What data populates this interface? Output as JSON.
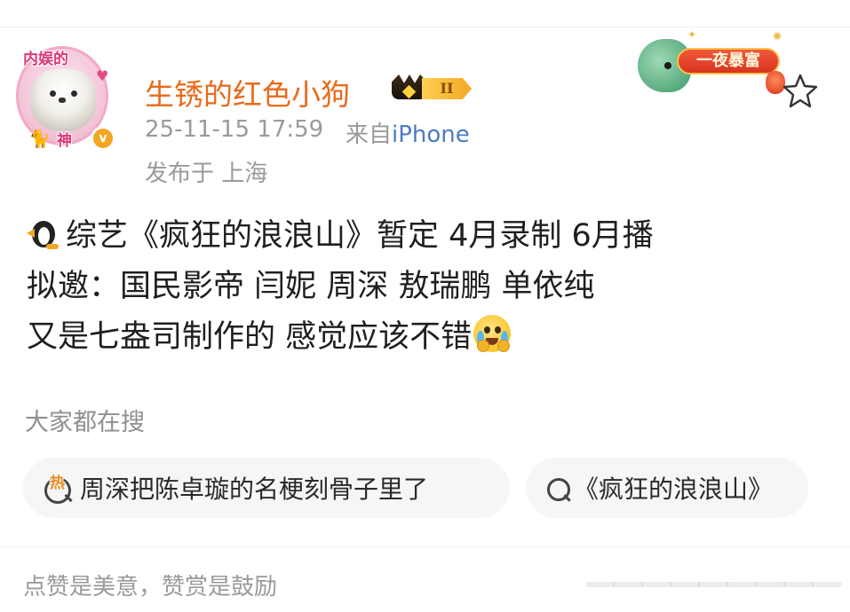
{
  "post": {
    "author": {
      "name": "生锈的红色小狗",
      "avatar_title": "内娱的",
      "avatar_bottom": "神",
      "verified_mark": "v",
      "vip_level": "II"
    },
    "timestamp": "25-11-15 17:59",
    "source_prefix": "来自",
    "source_device": "iPhone",
    "location": "发布于 上海",
    "decoration_label": "一夜暴富",
    "content": {
      "line1": "综艺《疯狂的浪浪山》暂定 4月录制 6月播",
      "line2": "拟邀：国民影帝 闫妮 周深 敖瑞鹏 单依纯",
      "line3": "又是七盎司制作的 感觉应该不错"
    }
  },
  "search": {
    "heading": "大家都在搜",
    "hot_mark": "热",
    "chips": [
      {
        "label": "周深把陈卓璇的名梗刻骨子里了",
        "icon": "hot-search-icon"
      },
      {
        "label": "《疯狂的浪浪山》",
        "icon": "search-icon"
      }
    ]
  },
  "footer": {
    "reward_text": "点赞是美意，赞赏是鼓励"
  },
  "icons": [
    "penguin-icon",
    "crying-emoji-icon",
    "star-icon",
    "crown-icon",
    "verified-icon"
  ],
  "colors": {
    "username": "#e86a1a",
    "link": "#4a7cc6",
    "meta_text": "#9a9a9a",
    "chip_bg": "#f6f6f6",
    "hot_accent": "#f08a1c"
  }
}
